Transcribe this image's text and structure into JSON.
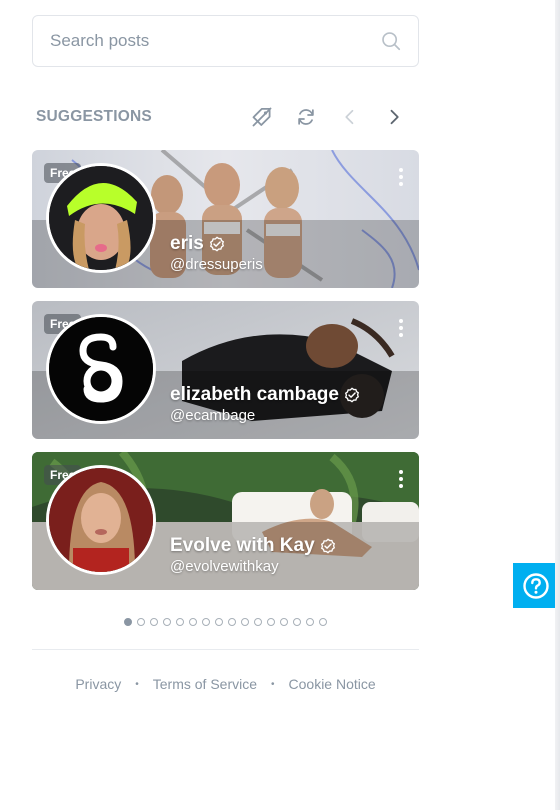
{
  "search": {
    "placeholder": "Search posts",
    "icon": "search-icon"
  },
  "suggestions": {
    "title": "SUGGESTIONS",
    "tools": [
      "hide-paid-filter-icon",
      "refresh-icon",
      "chevron-left-icon",
      "chevron-right-icon"
    ],
    "cards": [
      {
        "badge": "Free",
        "name": "eris",
        "handle": "@dressuperis",
        "verified": true
      },
      {
        "badge": "Free",
        "name": "elizabeth cambage",
        "handle": "@ecambage",
        "verified": true
      },
      {
        "badge": "Free",
        "name": "Evolve with Kay",
        "handle": "@evolvewithkay",
        "verified": true
      }
    ],
    "pager": {
      "total": 16,
      "active": 1
    }
  },
  "footer": {
    "privacy": "Privacy",
    "terms": "Terms of Service",
    "cookie": "Cookie Notice",
    "separator": "•"
  },
  "help": {
    "icon": "help-question-icon"
  },
  "colors": {
    "accent": "#00aff0",
    "muted": "#8a96a3",
    "border": "#e2e5ea"
  }
}
